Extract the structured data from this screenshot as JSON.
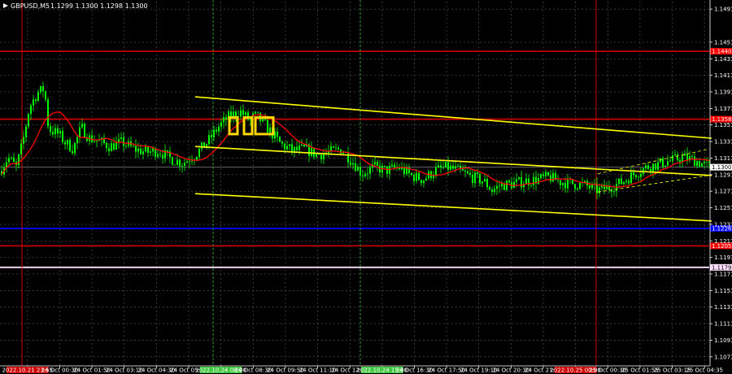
{
  "header": {
    "symbol_label": "GBPUSD,M5",
    "quote_values": "1.1299 1.1300 1.1298 1.1300"
  },
  "chart_data": {
    "type": "candlestick",
    "title": "GBPUSD,M5",
    "ylim": [
      1.106,
      1.15
    ],
    "y_ticks": [
      "1.1491",
      "1.1451",
      "1.1431",
      "1.1411",
      "1.1391",
      "1.1371",
      "1.1351",
      "1.1331",
      "1.1311",
      "1.1291",
      "1.1271",
      "1.1251",
      "1.1231",
      "1.1211",
      "1.1191",
      "1.1171",
      "1.1151",
      "1.1131",
      "1.1111",
      "1.1091",
      "1.1071"
    ],
    "x_ticks": [
      "2022.10.21 23:55",
      "24 Oct 00:30",
      "24 Oct 01:50",
      "24 Oct 03:10",
      "24 Oct 04:30",
      "24 Oct 05:50",
      "2022.10.24 08:00",
      "24 Oct 08:30",
      "24 Oct 09:50",
      "24 Oct 11:10",
      "24 Oct 12:30",
      "2022.10.24 15:00",
      "24 Oct 16:30",
      "24 Oct 17:50",
      "24 Oct 19:10",
      "24 Oct 20:30",
      "24 Oct 21:50",
      "2022.10.25 00:00",
      "25 Oct 00:30",
      "25 Oct 01:55",
      "25 Oct 03:15",
      "25 Oct 04:35"
    ],
    "current_price": 1.13,
    "current_price_label": "1.1300",
    "price_path": [
      [
        0,
        1.1295
      ],
      [
        10,
        1.1312
      ],
      [
        20,
        1.13
      ],
      [
        28,
        1.133
      ],
      [
        36,
        1.1372
      ],
      [
        46,
        1.139
      ],
      [
        55,
        1.1395
      ],
      [
        58,
        1.1355
      ],
      [
        62,
        1.1345
      ],
      [
        72,
        1.134
      ],
      [
        80,
        1.133
      ],
      [
        90,
        1.1322
      ],
      [
        100,
        1.1348
      ],
      [
        110,
        1.1335
      ],
      [
        120,
        1.1332
      ],
      [
        135,
        1.1325
      ],
      [
        150,
        1.133
      ],
      [
        165,
        1.1322
      ],
      [
        180,
        1.1318
      ],
      [
        195,
        1.132
      ],
      [
        210,
        1.131
      ],
      [
        225,
        1.1305
      ],
      [
        240,
        1.1315
      ],
      [
        255,
        1.133
      ],
      [
        268,
        1.1348
      ],
      [
        280,
        1.136
      ],
      [
        295,
        1.1368
      ],
      [
        305,
        1.1358
      ],
      [
        315,
        1.1362
      ],
      [
        325,
        1.1352
      ],
      [
        335,
        1.134
      ],
      [
        345,
        1.1328
      ],
      [
        360,
        1.132
      ],
      [
        375,
        1.1322
      ],
      [
        390,
        1.1315
      ],
      [
        405,
        1.1318
      ],
      [
        420,
        1.1322
      ],
      [
        435,
        1.1305
      ],
      [
        445,
        1.1292
      ],
      [
        460,
        1.13
      ],
      [
        475,
        1.1296
      ],
      [
        490,
        1.13
      ],
      [
        505,
        1.129
      ],
      [
        520,
        1.1285
      ],
      [
        535,
        1.1296
      ],
      [
        550,
        1.13
      ],
      [
        565,
        1.1295
      ],
      [
        580,
        1.1288
      ],
      [
        595,
        1.1283
      ],
      [
        605,
        1.1272
      ],
      [
        615,
        1.1278
      ],
      [
        630,
        1.128
      ],
      [
        645,
        1.1283
      ],
      [
        660,
        1.1285
      ],
      [
        675,
        1.1288
      ],
      [
        690,
        1.1282
      ],
      [
        705,
        1.128
      ],
      [
        720,
        1.1278
      ],
      [
        735,
        1.1272
      ],
      [
        750,
        1.1276
      ],
      [
        765,
        1.1282
      ],
      [
        780,
        1.1292
      ],
      [
        795,
        1.13
      ],
      [
        810,
        1.1304
      ],
      [
        825,
        1.1308
      ],
      [
        840,
        1.1312
      ],
      [
        855,
        1.1308
      ],
      [
        868,
        1.1302
      ],
      [
        875,
        1.13
      ]
    ],
    "red_levels": [
      {
        "price": 1.144,
        "label": "1.1440"
      },
      {
        "price": 1.1358,
        "label": "1.1358"
      },
      {
        "price": 1.1205,
        "label": "1.1205"
      }
    ],
    "blue_levels": [
      {
        "price": 1.1226,
        "label": "1.1226"
      }
    ],
    "white_levels": [
      {
        "price": 1.1179,
        "label": "1.1179"
      }
    ],
    "channel_upper": [
      [
        1.1385,
        240
      ],
      [
        1.1335,
        875
      ]
    ],
    "channel_mid": [
      [
        1.1325,
        240
      ],
      [
        1.129,
        875
      ]
    ],
    "channel_lower": [
      [
        1.1268,
        240
      ],
      [
        1.1235,
        875
      ]
    ],
    "red_vertical_x_labels": [
      "2022.10.21 23:55",
      "2022.10.25 00:00"
    ],
    "green_vertical_x_labels": [
      "2022.10.24 08:00",
      "2022.10.24 15:00"
    ],
    "signal_boxes": 3,
    "colors": {
      "background": "#000000",
      "candles": "#00ff00",
      "grid": "#5a5a5a",
      "ma": "#ff0000",
      "channel": "#ffff00",
      "signal_box": "#ffd700",
      "red_level": "#c00000",
      "blue_level": "#0000ff",
      "white_level": "#ffe0ff"
    }
  }
}
